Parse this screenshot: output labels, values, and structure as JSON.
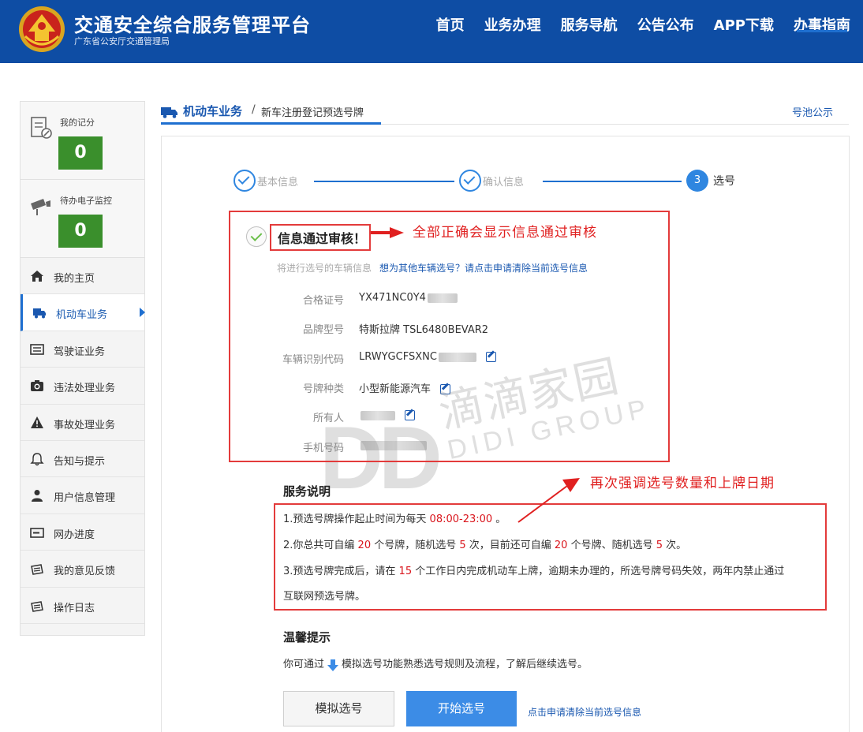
{
  "header": {
    "title": "交通安全综合服务管理平台",
    "subtitle": "广东省公安厅交通管理局",
    "nav": [
      "首页",
      "业务办理",
      "服务导航",
      "公告公布",
      "APP下载",
      "办事指南"
    ]
  },
  "sidebar": {
    "stats": [
      {
        "label": "我的记分",
        "value": "0",
        "icon": "document-pen-icon"
      },
      {
        "label": "待办电子监控",
        "value": "0",
        "icon": "camera-icon"
      }
    ],
    "items": [
      {
        "label": "我的主页",
        "icon": "home-icon"
      },
      {
        "label": "机动车业务",
        "icon": "truck-icon"
      },
      {
        "label": "驾驶证业务",
        "icon": "id-card-icon"
      },
      {
        "label": "违法处理业务",
        "icon": "camera-icon"
      },
      {
        "label": "事故处理业务",
        "icon": "warning-icon"
      },
      {
        "label": "告知与提示",
        "icon": "bell-icon"
      },
      {
        "label": "用户信息管理",
        "icon": "user-icon"
      },
      {
        "label": "网办进度",
        "icon": "progress-icon"
      },
      {
        "label": "我的意见反馈",
        "icon": "feedback-icon"
      },
      {
        "label": "操作日志",
        "icon": "log-icon"
      }
    ],
    "active_index": 1
  },
  "breadcrumb": {
    "section": "机动车业务",
    "separator": "/",
    "current": "新车注册登记预选号牌",
    "right_link": "号池公示"
  },
  "steps": [
    {
      "label": "基本信息",
      "status": "done"
    },
    {
      "label": "确认信息",
      "status": "done"
    },
    {
      "number": "3",
      "label": "选号",
      "status": "active"
    }
  ],
  "verification": {
    "title": "信息通过审核！",
    "vehicle_info_label": "将进行选号的车辆信息",
    "other_vehicle_link": "想为其他车辆选号？请点击申请清除当前选号信息"
  },
  "fields": [
    {
      "label": "合格证号",
      "value": "YX471NC0Y4",
      "editable": false
    },
    {
      "label": "品牌型号",
      "value": "特斯拉牌 TSL6480BEVAR2",
      "editable": false
    },
    {
      "label": "车辆识别代码",
      "value": "LRWYGCFSXNC",
      "editable": true
    },
    {
      "label": "号牌种类",
      "value": "小型新能源汽车",
      "editable": true
    },
    {
      "label": "所有人",
      "value": "",
      "editable": true
    },
    {
      "label": "手机号码",
      "value": "",
      "editable": false
    }
  ],
  "service": {
    "title": "服务说明",
    "line1": {
      "a": "1.预选号牌操作起止时间为每天 ",
      "time": "08:00-23:00",
      "b": " 。"
    },
    "line2": {
      "a": "2.你总共可自编 ",
      "n1": "20",
      "b": " 个号牌，随机选号 ",
      "n2": "5",
      "c": " 次，目前还可自编 ",
      "n3": "20",
      "d": " 个号牌、随机选号 ",
      "n4": "5",
      "e": " 次。"
    },
    "line3": {
      "a": "3.预选号牌完成后，请在 ",
      "n1": "15",
      "b": " 个工作日内完成机动车上牌，逾期未办理的，所选号牌号码失效，两年内禁止通过"
    },
    "line3b": "互联网预选号牌。"
  },
  "tips": {
    "title": "温馨提示",
    "before": "你可通过",
    "after": "模拟选号功能熟悉选号规则及流程，了解后继续选号。"
  },
  "buttons": {
    "simulate": "模拟选号",
    "start": "开始选号",
    "clear_link": "点击申请清除当前选号信息"
  },
  "annotations": {
    "note1": "全部正确会显示信息通过审核",
    "note2": "再次强调选号数量和上牌日期",
    "color": "#e02020"
  },
  "watermark": {
    "logo": "DD",
    "cn": "滴滴家园",
    "en": "DIDI GROUP"
  },
  "colors": {
    "header_bg": "#0e4da4",
    "accent": "#1e6fd0",
    "stat_green": "#3a8f2c",
    "highlight_red": "#d9141b"
  }
}
